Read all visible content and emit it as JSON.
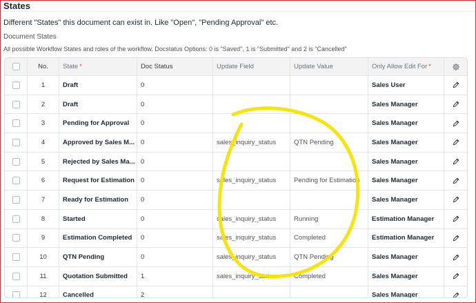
{
  "section": {
    "title": "States",
    "description": "Different \"States\" this document can exist in. Like \"Open\", \"Pending Approval\" etc."
  },
  "field": {
    "label": "Document States",
    "description": "All possible Workflow States and roles of the workflow. Docstatus Options: 0 is \"Saved\", 1 is \"Submitted\" and 2 is \"Cancelled\""
  },
  "table": {
    "columns": {
      "no": "No.",
      "state": "State",
      "doc_status": "Doc Status",
      "update_field": "Update Field",
      "update_value": "Update Value",
      "allow_edit": "Only Allow Edit For",
      "required_mark": "*"
    },
    "rows": [
      {
        "no": "1",
        "state": "Draft",
        "doc_status": "0",
        "update_field": "",
        "update_value": "",
        "allow_edit": "Sales User"
      },
      {
        "no": "2",
        "state": "Draft",
        "doc_status": "0",
        "update_field": "",
        "update_value": "",
        "allow_edit": "Sales Manager"
      },
      {
        "no": "3",
        "state": "Pending for Approval",
        "doc_status": "0",
        "update_field": "",
        "update_value": "",
        "allow_edit": "Sales Manager"
      },
      {
        "no": "4",
        "state": "Approved by Sales M...",
        "doc_status": "0",
        "update_field": "sales_inquiry_status",
        "update_value": "QTN Pending",
        "allow_edit": "Sales Manager"
      },
      {
        "no": "5",
        "state": "Rejected by Sales Ma...",
        "doc_status": "0",
        "update_field": "",
        "update_value": "",
        "allow_edit": "Sales Manager"
      },
      {
        "no": "6",
        "state": "Request for Estimation",
        "doc_status": "0",
        "update_field": "sales_inquiry_status",
        "update_value": "Pending for Estimation",
        "allow_edit": "Sales Manager"
      },
      {
        "no": "7",
        "state": "Ready for Estimation",
        "doc_status": "0",
        "update_field": "",
        "update_value": "",
        "allow_edit": "Sales Manager"
      },
      {
        "no": "8",
        "state": "Started",
        "doc_status": "0",
        "update_field": "sales_inquiry_status",
        "update_value": "Running",
        "allow_edit": "Estimation Manager"
      },
      {
        "no": "9",
        "state": "Estimation Completed",
        "doc_status": "0",
        "update_field": "sales_inquiry_status",
        "update_value": "Completed",
        "allow_edit": "Estimation Manager"
      },
      {
        "no": "10",
        "state": "QTN Pending",
        "doc_status": "0",
        "update_field": "sales_inquiry_status",
        "update_value": "QTN Pending",
        "allow_edit": "Sales Manager"
      },
      {
        "no": "11",
        "state": "Quotation Submitted",
        "doc_status": "1",
        "update_field": "sales_inquiry_status",
        "update_value": "Completed",
        "allow_edit": "Sales Manager"
      },
      {
        "no": "12",
        "state": "Cancelled",
        "doc_status": "2",
        "update_field": "",
        "update_value": "",
        "allow_edit": "Sales Manager"
      }
    ]
  },
  "icons": {
    "settings": "gear-icon",
    "edit": "pencil-edit-icon"
  },
  "colors": {
    "frame_border": "#d32f2f",
    "highlight": "#f5e400",
    "required": "#e24c4c"
  }
}
